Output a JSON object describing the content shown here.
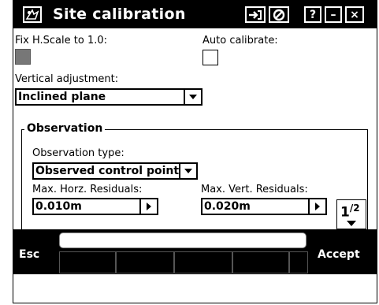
{
  "window": {
    "title": "Site calibration",
    "icons": [
      "app-icon",
      "import-icon",
      "cancel-icon",
      "help-icon",
      "minimize-icon",
      "close-icon"
    ],
    "help_label": "?",
    "minimize_label": "–",
    "close_label": "×"
  },
  "settings": {
    "fix_hscale_label": "Fix H.Scale to 1.0:",
    "fix_hscale_checked": true,
    "auto_calibrate_label": "Auto calibrate:",
    "auto_calibrate_checked": false,
    "vertical_adjustment_label": "Vertical adjustment:",
    "vertical_adjustment_value": "Inclined plane"
  },
  "observation": {
    "legend": "Observation",
    "type_label": "Observation type:",
    "type_value": "Observed control point",
    "max_horz_label": "Max. Horz. Residuals:",
    "max_horz_value": "0.010m",
    "max_vert_label": "Max. Vert. Residuals:",
    "max_vert_value": "0.020m"
  },
  "pager": {
    "current": "1",
    "total": "2"
  },
  "softkeys": {
    "esc": "Esc",
    "accept": "Accept"
  }
}
